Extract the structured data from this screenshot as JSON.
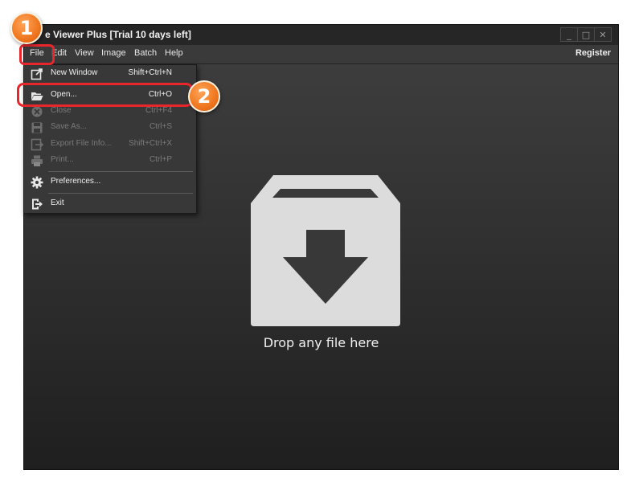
{
  "window": {
    "title": "e Viewer Plus [Trial 10 days left]",
    "controls": [
      "_",
      "□",
      "✕"
    ]
  },
  "menubar": {
    "items": [
      {
        "label": "File"
      },
      {
        "label": "Edit"
      },
      {
        "label": "View"
      },
      {
        "label": "Image"
      },
      {
        "label": "Batch"
      },
      {
        "label": "Help"
      }
    ],
    "register_label": "Register"
  },
  "file_menu": {
    "items": [
      {
        "icon": "new-window-icon",
        "label": "New Window",
        "shortcut": "Shift+Ctrl+N",
        "enabled": true
      },
      {
        "icon": "open-folder-icon",
        "label": "Open...",
        "shortcut": "Ctrl+O",
        "enabled": true
      },
      {
        "icon": "close-icon",
        "label": "Close",
        "shortcut": "Ctrl+F4",
        "enabled": false
      },
      {
        "icon": "save-icon",
        "label": "Save As...",
        "shortcut": "Ctrl+S",
        "enabled": false
      },
      {
        "icon": "export-icon",
        "label": "Export File Info...",
        "shortcut": "Shift+Ctrl+X",
        "enabled": false
      },
      {
        "icon": "print-icon",
        "label": "Print...",
        "shortcut": "Ctrl+P",
        "enabled": false
      },
      {
        "icon": "gear-icon",
        "label": "Preferences...",
        "shortcut": "",
        "enabled": true
      },
      {
        "icon": "exit-icon",
        "label": "Exit",
        "shortcut": "",
        "enabled": true
      }
    ]
  },
  "drop_area": {
    "icon": "box-download-icon",
    "text": "Drop any file here"
  },
  "annotations": {
    "step1": "1",
    "step2": "2",
    "highlight_color": "#e8262b",
    "badge_color": "#f07a22"
  }
}
